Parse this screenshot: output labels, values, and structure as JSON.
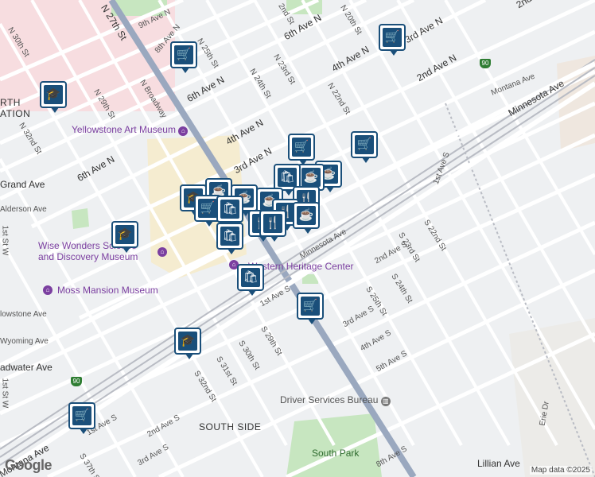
{
  "streets": {
    "ave_n_9th": "9th Ave N",
    "ave_n_8th": "8th Ave N",
    "ave_n_6th_w": "6th Ave N",
    "ave_n_6th_e": "6th Ave N",
    "ave_n_4th_w": "4th Ave N",
    "ave_n_4th_e": "4th Ave N",
    "ave_n_3rd": "3rd Ave N",
    "ave_n_3rd_e": "3rd Ave N",
    "ave_n_2nd": "2nd Ave N",
    "ave_n_2nd_tr": "2nd",
    "montana": "Montana Ave",
    "montana_w": "Montana Ave",
    "minnesota": "Minnesota Ave",
    "minnesota_s": "Minnesota Ave",
    "grand": "Grand Ave",
    "alderson": "Alderson Ave",
    "yellowstone": "lowstone Ave",
    "wyoming": "Wyoming Ave",
    "broadwater": "adwater Ave",
    "n27": "N 27th St",
    "n30": "N 30th St",
    "n29": "N 29th St",
    "n25": "N 25th St",
    "n24": "N 24th St",
    "n23": "N 23rd St",
    "n22": "N 22nd St",
    "n20": "N 20th St",
    "n2nd": "2nd St",
    "n32": "N 32nd St",
    "broadway": "N Broadway",
    "w1st": "1st St W",
    "w1st_b": "1st St W",
    "s1st_ave_e": "1st Ave S",
    "s1st_ave_w": "1st Ave S",
    "s2nd_ave": "2nd Ave S",
    "s2nd_ave_w": "2nd Ave S",
    "s3rd_ave": "3rd Ave S",
    "s3rd_ave_w": "3rd Ave S",
    "s4th_ave": "4th Ave S",
    "s5th_ave": "5th Ave S",
    "s8th_ave": "8th Ave S",
    "s22": "S 22nd St",
    "s23": "S 23rd St",
    "s24": "S 24th St",
    "s25": "S 25th St",
    "s29": "S 29th St",
    "s30": "S 30th St",
    "s31": "S 31st St",
    "s32": "S 32nd St",
    "s37": "S 37th St",
    "lillian": "Lillian Ave",
    "erie": "Erie Dr"
  },
  "places": {
    "art_museum": "Yellowstone Art Museum",
    "wise_line1": "Wise Wonders Science",
    "wise_line2": "and Discovery Museum",
    "moss": "Moss Mansion Museum",
    "western": "Western Heritage Center",
    "driver": "Driver Services Bureau",
    "south_park": "South Park",
    "south_side": "SOUTH SIDE",
    "north_line1": "RTH",
    "north_line2": "ATION"
  },
  "highways": {
    "i90_ne": "90",
    "i90_sw": "90"
  },
  "icons": {
    "grocery": "🛒",
    "shopping": "🛍",
    "school": "🎓",
    "cafe": "☕",
    "restaurant": "🍴"
  },
  "colors": {
    "pin": "#1a4f7a",
    "poi": "#7b3fa0",
    "park": "#c7e6c0"
  },
  "google_logo": "Google",
  "attribution": "Map data ©2025"
}
